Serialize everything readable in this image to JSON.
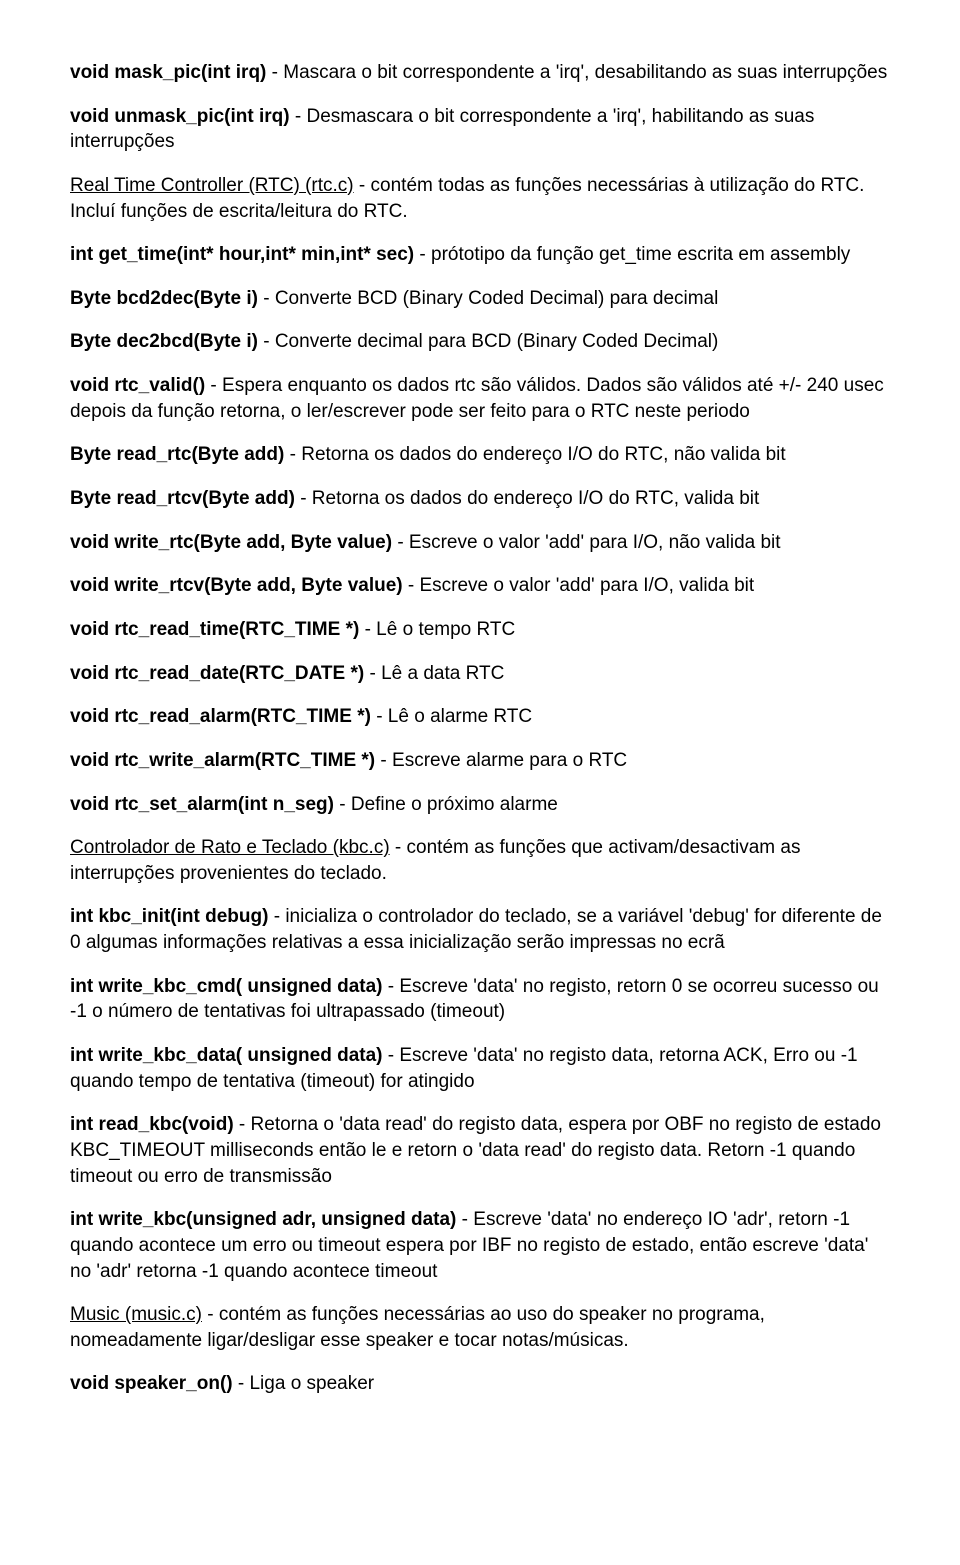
{
  "p1": {
    "b": "void mask_pic(int irq)",
    "t": " - Mascara o bit correspondente a 'irq', desabilitando as suas interrupções"
  },
  "p2": {
    "b": "void unmask_pic(int irq)",
    "t": " - Desmascara o bit correspondente a 'irq', habilitando as suas interrupções"
  },
  "p3": {
    "u": "Real Time Controller (RTC) (rtc.c)",
    "t": " - contém todas as funções necessárias à utilização do RTC. Incluí funções de escrita/leitura do RTC."
  },
  "p4": {
    "b": "int get_time(int* hour,int* min,int* sec)",
    "t": " - prótotipo da função get_time escrita em assembly"
  },
  "p5": {
    "b": "Byte bcd2dec(Byte i)",
    "t": " - Converte BCD (Binary Coded Decimal) para decimal"
  },
  "p6": {
    "b": "Byte dec2bcd(Byte i)",
    "t": " - Converte decimal para BCD (Binary Coded Decimal)"
  },
  "p7": {
    "b": "void rtc_valid()",
    "t": " - Espera enquanto os dados rtc são válidos. Dados são válidos até +/- 240 usec depois da função retorna, o ler/escrever pode ser feito para o RTC neste periodo"
  },
  "p8": {
    "b": "Byte read_rtc(Byte add)",
    "t": " - Retorna os dados do endereço I/O do RTC, não valida bit"
  },
  "p9": {
    "b": "Byte read_rtcv(Byte add)",
    "t": " - Retorna os dados do endereço I/O do RTC, valida bit"
  },
  "p10": {
    "b": "void write_rtc(Byte add, Byte value)",
    "t": " - Escreve o valor 'add' para I/O, não valida bit"
  },
  "p11": {
    "b": "void write_rtcv(Byte add, Byte value)",
    "t": " - Escreve o valor 'add' para I/O, valida bit"
  },
  "p12": {
    "b": "void rtc_read_time(RTC_TIME *)",
    "t": " - Lê o tempo RTC"
  },
  "p13": {
    "b": "void rtc_read_date(RTC_DATE *)",
    "t": " - Lê a data RTC"
  },
  "p14": {
    "b": "void rtc_read_alarm(RTC_TIME *)",
    "t": " - Lê o alarme RTC"
  },
  "p15": {
    "b": "void rtc_write_alarm(RTC_TIME *)",
    "t": " - Escreve alarme para o RTC"
  },
  "p16": {
    "b": "void rtc_set_alarm(int n_seg)",
    "t": " - Define o próximo alarme"
  },
  "p17": {
    "u": "Controlador de Rato e Teclado (kbc.c)",
    "t": " - contém as funções que activam/desactivam as interrupções provenientes do teclado."
  },
  "p18": {
    "b": "int kbc_init(int debug)",
    "t": " - inicializa o controlador do teclado, se a variável 'debug' for diferente de 0 algumas informações relativas a essa inicialização serão impressas no ecrã"
  },
  "p19": {
    "b": "int write_kbc_cmd( unsigned data)",
    "t": " - Escreve 'data' no registo, retorn 0 se ocorreu sucesso ou -1 o número de tentativas foi ultrapassado (timeout)"
  },
  "p20": {
    "b": "int write_kbc_data( unsigned data)",
    "t": " - Escreve 'data' no registo data, retorna ACK, Erro ou -1 quando tempo de tentativa (timeout) for atingido"
  },
  "p21": {
    "b": "int read_kbc(void)",
    "t": " - Retorna o 'data read' do registo data, espera por OBF no registo de estado KBC_TIMEOUT milliseconds então le e retorn o 'data read' do registo data. Retorn -1 quando timeout ou erro de transmissão"
  },
  "p22": {
    "b": "int write_kbc(unsigned adr, unsigned data)",
    "t": " - Escreve 'data' no endereço IO 'adr', retorn -1 quando acontece um erro ou timeout espera por IBF no registo de estado, então escreve 'data' no 'adr' retorna -1 quando acontece timeout"
  },
  "p23": {
    "u": "Music (music.c)",
    "t": " - contém as funções necessárias ao uso do speaker no programa, nomeadamente ligar/desligar esse speaker e tocar notas/músicas."
  },
  "p24": {
    "b": "void speaker_on()",
    "t": " - Liga o speaker"
  }
}
